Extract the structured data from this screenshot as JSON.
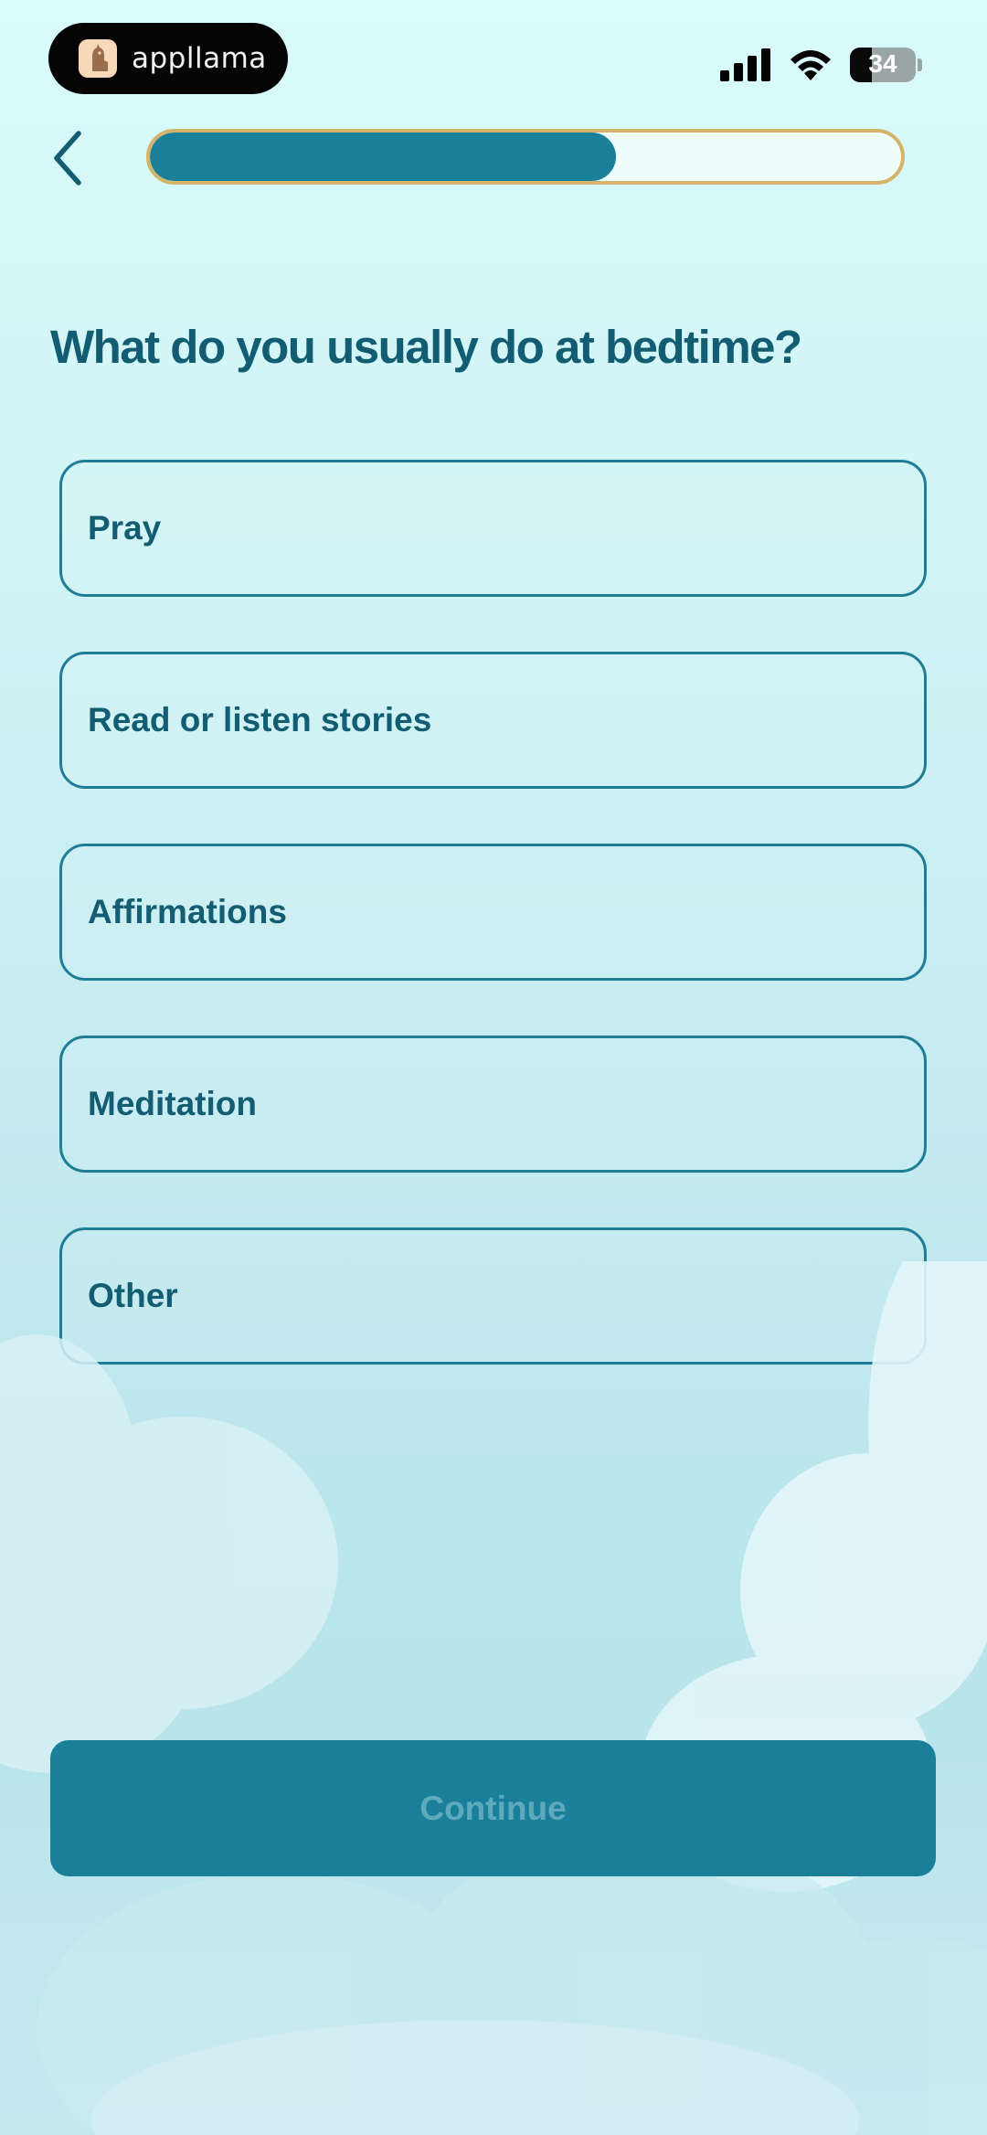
{
  "status_bar": {
    "app_pill_label": "appllama",
    "battery_level": "34",
    "icons": [
      "llama-logo-icon",
      "cellular-signal-icon",
      "wifi-icon",
      "battery-icon"
    ]
  },
  "nav": {
    "back_icon": "chevron-left-icon",
    "progress_fraction": 0.62
  },
  "question": {
    "title": "What do you usually do at bedtime?"
  },
  "options": [
    {
      "label": "Pray"
    },
    {
      "label": "Read or listen stories"
    },
    {
      "label": "Affirmations"
    },
    {
      "label": "Meditation"
    },
    {
      "label": "Other"
    }
  ],
  "footer": {
    "continue_label": "Continue"
  },
  "colors": {
    "accent": "#1a809a",
    "text": "#135d73",
    "progress_border": "#d4b36a",
    "background_top": "#d9fbfb",
    "background_bottom": "#b9e4ec"
  }
}
